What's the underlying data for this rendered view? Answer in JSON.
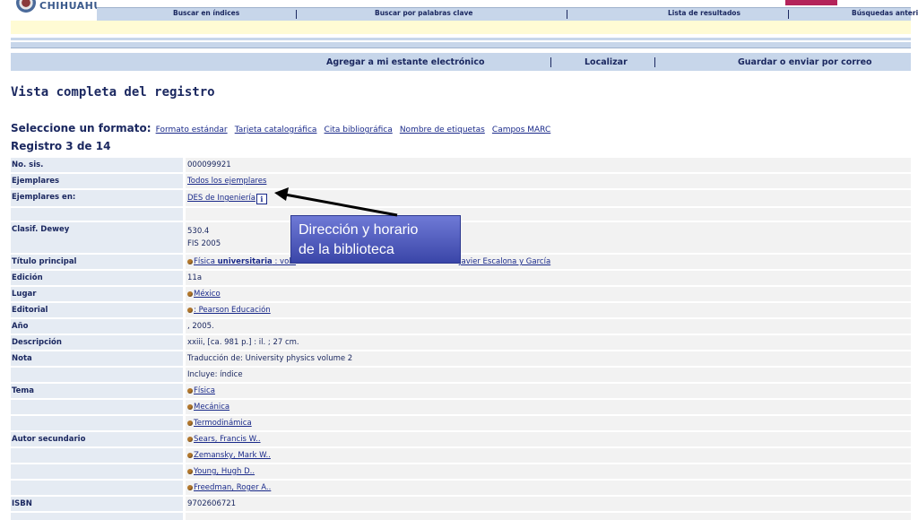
{
  "logo": {
    "text": "CHIHUAHUA"
  },
  "topnav": {
    "items": [
      "Buscar en índices",
      "Buscar por palabras clave",
      "Lista de resultados",
      "Búsquedas anteri"
    ]
  },
  "actions": {
    "items": [
      "Agregar a mi estante electrónico",
      "Localizar",
      "Guardar o enviar por correo"
    ]
  },
  "page": {
    "title": "Vista completa del registro",
    "format_label": "Seleccione un formato:",
    "formats": [
      "Formato estándar",
      "Tarjeta catalográfica",
      "Cita bibliográfica",
      "Nombre de etiquetas",
      "Campos MARC"
    ],
    "record": "Registro 3 de 14"
  },
  "record": {
    "no_sis": {
      "label": "No. sis.",
      "value": "000099921"
    },
    "ejemplares": {
      "label": "Ejemplares",
      "value": "Todos los ejemplares"
    },
    "ejemplares_en": {
      "label": "Ejemplares en:",
      "value": "DES de Ingeniería",
      "icon": "info-icon"
    },
    "dewey": {
      "label": "Clasif. Dewey",
      "line1": "530.4",
      "line2": "FIS 2005"
    },
    "titulo": {
      "label": "Título principal",
      "part1": "Física ",
      "part2": "universitaria",
      "part3": " : volu",
      "author_tail": "Javier Escalona y García"
    },
    "edicion": {
      "label": "Edición",
      "value": "11a"
    },
    "lugar": {
      "label": "Lugar",
      "value": "México"
    },
    "editorial": {
      "label": "Editorial",
      "value": ": Pearson Educación"
    },
    "anio": {
      "label": "Año",
      "value": ", 2005."
    },
    "descripcion": {
      "label": "Descripción",
      "value": "xxiii, [ca. 981 p.] : il. ; 27 cm."
    },
    "nota": {
      "label": "Nota",
      "value1": "Traducción de: University physics volume 2",
      "value2": "Incluye: índice"
    },
    "tema": {
      "label": "Tema",
      "values": [
        "Física",
        "Mecánica",
        "Termodinámica"
      ]
    },
    "autor": {
      "label": "Autor secundario",
      "values": [
        "Sears, Francis W..",
        "Zemansky, Mark W..",
        "Young, Hugh D..",
        "Freedman, Roger A.."
      ]
    },
    "isbn": {
      "label": "ISBN",
      "value": "9702606721"
    }
  },
  "callout": {
    "line1": "Dirección y horario",
    "line2": "de la biblioteca"
  },
  "colors": {
    "nav_bg": "#c7d6ea",
    "label_bg": "#e5ebf3",
    "value_bg": "#f2f2f2",
    "callout_bg": "#4a56b8",
    "accent_pink": "#b4235a"
  }
}
